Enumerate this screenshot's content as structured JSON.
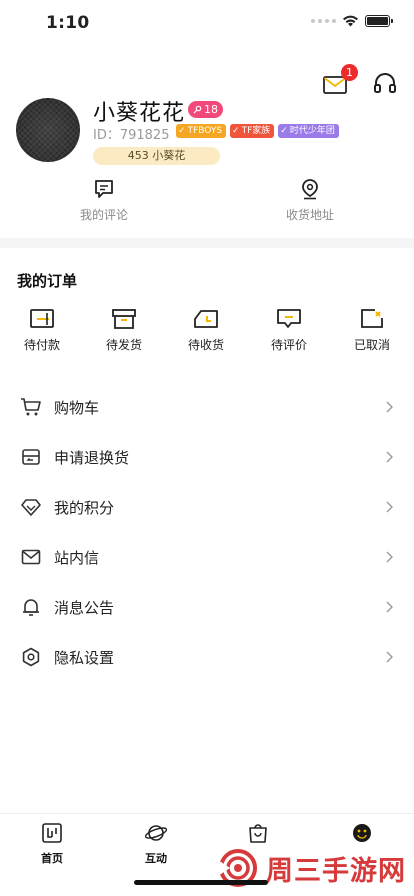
{
  "status_bar": {
    "time": "1:10"
  },
  "header": {
    "unread_count": "1"
  },
  "profile": {
    "nickname": "小葵花花",
    "level": "18",
    "uid": "ID：791825",
    "tags": [
      {
        "label": "TFBOYS",
        "color": "#f5a623"
      },
      {
        "label": "TF家族",
        "color": "#f0553c"
      },
      {
        "label": "时代少年团",
        "color": "#9b7be8"
      }
    ],
    "points": "453 小葵花"
  },
  "quick_links": [
    {
      "label": "我的评论",
      "icon": "comment-icon"
    },
    {
      "label": "收货地址",
      "icon": "location-icon"
    }
  ],
  "orders": {
    "title": "我的订单",
    "items": [
      {
        "label": "待付款",
        "icon": "wallet-icon"
      },
      {
        "label": "待发货",
        "icon": "box-icon"
      },
      {
        "label": "待收货",
        "icon": "truck-icon"
      },
      {
        "label": "待评价",
        "icon": "review-icon"
      },
      {
        "label": "已取消",
        "icon": "cancelled-icon"
      }
    ]
  },
  "menu": [
    {
      "label": "购物车",
      "icon": "cart-icon"
    },
    {
      "label": "申请退换货",
      "icon": "return-icon"
    },
    {
      "label": "我的积分",
      "icon": "diamond-icon"
    },
    {
      "label": "站内信",
      "icon": "mail-icon"
    },
    {
      "label": "消息公告",
      "icon": "bell-icon"
    },
    {
      "label": "隐私设置",
      "icon": "gear-icon"
    }
  ],
  "tabbar": [
    {
      "label": "首页",
      "icon": "home-icon"
    },
    {
      "label": "互动",
      "icon": "planet-icon"
    },
    {
      "label": "",
      "icon": "shop-bag-icon"
    },
    {
      "label": "",
      "icon": "me-icon"
    }
  ],
  "watermark": {
    "text": "周三手游网"
  },
  "colors": {
    "badge": "#ee2b2b",
    "level": "#f2497a",
    "points_bg": "#fcebc2",
    "accent": "#f5b800"
  }
}
